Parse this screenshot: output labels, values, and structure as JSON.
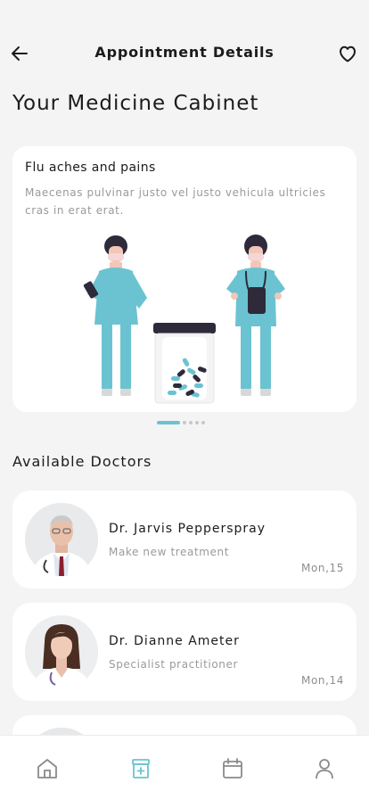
{
  "header": {
    "title": "Appointment Details",
    "back_icon": "arrow-left-icon",
    "favorite_icon": "heart-icon"
  },
  "page_title": "Your Medicine Cabinet",
  "cabinet": {
    "title": "Flu aches and pains",
    "description": "Maecenas pulvinar justo vel justo vehicula ultricies cras in erat erat.",
    "carousel_pages": 5,
    "active_page": 1
  },
  "doctors_section": {
    "title": "Available Doctors",
    "doctors": [
      {
        "name": "Dr. Jarvis Pepperspray",
        "role": "Make new treatment",
        "date": "Mon,15"
      },
      {
        "name": "Dr. Dianne Ameter",
        "role": "Specialist practitioner",
        "date": "Mon,14"
      }
    ]
  },
  "bottom_nav": {
    "items": [
      "home-icon",
      "medical-box-icon",
      "calendar-icon",
      "profile-icon"
    ],
    "active": "medical-box-icon"
  },
  "colors": {
    "accent": "#6bc3d1",
    "background": "#f4f4f4",
    "card": "#ffffff",
    "muted_text": "#9a9a9a"
  }
}
